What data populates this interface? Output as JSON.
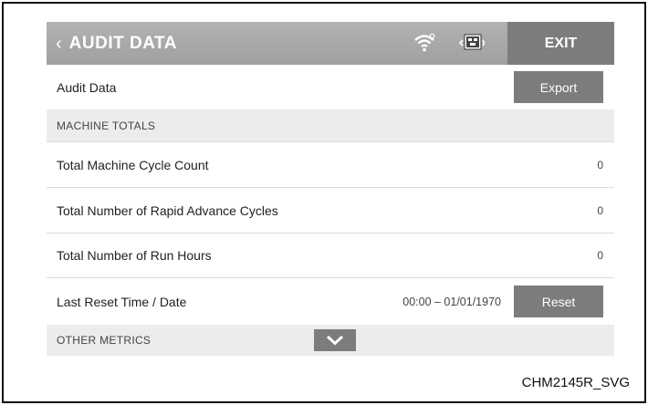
{
  "header": {
    "title": "AUDIT DATA",
    "exit_label": "EXIT",
    "icons": [
      "chevron-left-icon",
      "wifi-icon",
      "usb-icon"
    ]
  },
  "audit_row": {
    "label": "Audit Data",
    "export_label": "Export"
  },
  "machine_totals": {
    "heading": "MACHINE TOTALS",
    "rows": [
      {
        "label": "Total Machine Cycle Count",
        "value": "0"
      },
      {
        "label": "Total Number of Rapid Advance Cycles",
        "value": "0"
      },
      {
        "label": "Total Number of Run Hours",
        "value": "0"
      }
    ],
    "last_reset": {
      "label": "Last Reset Time / Date",
      "value": "00:00 – 01/01/1970",
      "reset_label": "Reset"
    }
  },
  "other_metrics": {
    "heading": "OTHER METRICS"
  },
  "caption": "CHM2145R_SVG",
  "colors": {
    "header": "#a8a8a8",
    "button": "#7c7c7c",
    "section_bg": "#ececec"
  }
}
